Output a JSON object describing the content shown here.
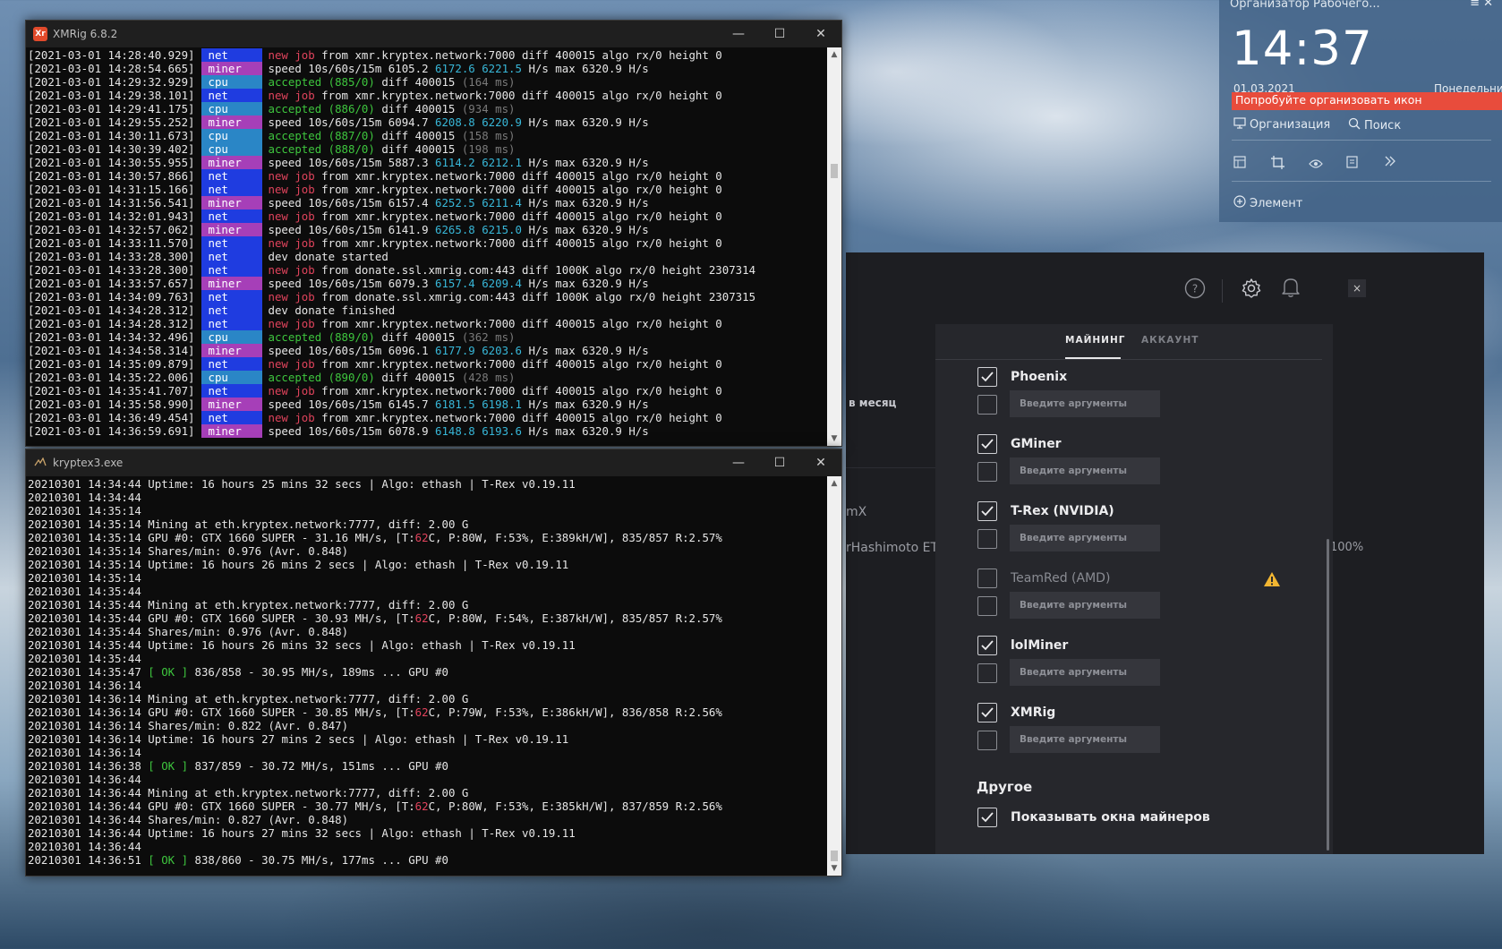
{
  "desktop": {
    "fences": {
      "header": "Организатор Рабочего...",
      "menu_glyph": "≡ ✕",
      "clock": "14:37",
      "date": "01.03.2021",
      "day": "Понедельник",
      "banner": "Попробуйте организовать икон",
      "organize_label": "Организация",
      "search_label": "Поиск",
      "element_label": "Элемент"
    }
  },
  "xmrig": {
    "title": "XMRig 6.8.2",
    "icon_text": "Xr",
    "lines": [
      {
        "ts": "[2021-03-01 14:28:40.929]",
        "tag": "net",
        "text": "new job from xmr.kryptex.network:7000 diff 400015 algo rx/0 height 0",
        "kind": "job"
      },
      {
        "ts": "[2021-03-01 14:28:54.665]",
        "tag": "miner",
        "text": "speed 10s/60s/15m 6105.2 6172.6 6221.5 H/s max 6320.9 H/s",
        "kind": "speed",
        "s1": "6105.2",
        "s2": "6172.6 6221.5",
        "max": "6320.9"
      },
      {
        "ts": "[2021-03-01 14:29:32.929]",
        "tag": "cpu",
        "text": "accepted (885/0) diff 400015 (164 ms)",
        "kind": "acc",
        "count": "(885/0)",
        "ms": "(164 ms)"
      },
      {
        "ts": "[2021-03-01 14:29:38.101]",
        "tag": "net",
        "text": "new job from xmr.kryptex.network:7000 diff 400015 algo rx/0 height 0",
        "kind": "job"
      },
      {
        "ts": "[2021-03-01 14:29:41.175]",
        "tag": "cpu",
        "text": "accepted (886/0) diff 400015 (934 ms)",
        "kind": "acc",
        "count": "(886/0)",
        "ms": "(934 ms)"
      },
      {
        "ts": "[2021-03-01 14:29:55.252]",
        "tag": "miner",
        "text": "speed",
        "kind": "speed",
        "s1": "6094.7",
        "s2": "6208.8 6220.9",
        "max": "6320.9"
      },
      {
        "ts": "[2021-03-01 14:30:11.673]",
        "tag": "cpu",
        "text": "accepted",
        "kind": "acc",
        "count": "(887/0)",
        "ms": "(158 ms)"
      },
      {
        "ts": "[2021-03-01 14:30:39.402]",
        "tag": "cpu",
        "text": "accepted",
        "kind": "acc",
        "count": "(888/0)",
        "ms": "(198 ms)"
      },
      {
        "ts": "[2021-03-01 14:30:55.955]",
        "tag": "miner",
        "text": "speed",
        "kind": "speed",
        "s1": "5887.3",
        "s2": "6114.2 6212.1",
        "max": "6320.9"
      },
      {
        "ts": "[2021-03-01 14:30:57.866]",
        "tag": "net",
        "text": "new job from xmr.kryptex.network:7000 diff 400015 algo rx/0 height 0",
        "kind": "job"
      },
      {
        "ts": "[2021-03-01 14:31:15.166]",
        "tag": "net",
        "text": "new job from xmr.kryptex.network:7000 diff 400015 algo rx/0 height 0",
        "kind": "job"
      },
      {
        "ts": "[2021-03-01 14:31:56.541]",
        "tag": "miner",
        "text": "speed",
        "kind": "speed",
        "s1": "6157.4",
        "s2": "6252.5 6211.4",
        "max": "6320.9"
      },
      {
        "ts": "[2021-03-01 14:32:01.943]",
        "tag": "net",
        "text": "new job from xmr.kryptex.network:7000 diff 400015 algo rx/0 height 0",
        "kind": "job"
      },
      {
        "ts": "[2021-03-01 14:32:57.062]",
        "tag": "miner",
        "text": "speed",
        "kind": "speed",
        "s1": "6141.9",
        "s2": "6265.8 6215.0",
        "max": "6320.9"
      },
      {
        "ts": "[2021-03-01 14:33:11.570]",
        "tag": "net",
        "text": "new job from xmr.kryptex.network:7000 diff 400015 algo rx/0 height 0",
        "kind": "job"
      },
      {
        "ts": "[2021-03-01 14:33:28.300]",
        "tag": "net",
        "text": "dev donate started",
        "kind": "plain"
      },
      {
        "ts": "[2021-03-01 14:33:28.300]",
        "tag": "net",
        "text": "new job from donate.ssl.xmrig.com:443 diff 1000K algo rx/0 height 2307314",
        "kind": "job"
      },
      {
        "ts": "[2021-03-01 14:33:57.657]",
        "tag": "miner",
        "text": "speed",
        "kind": "speed",
        "s1": "6079.3",
        "s2": "6157.4 6209.4",
        "max": "6320.9"
      },
      {
        "ts": "[2021-03-01 14:34:09.763]",
        "tag": "net",
        "text": "new job from donate.ssl.xmrig.com:443 diff 1000K algo rx/0 height 2307315",
        "kind": "job"
      },
      {
        "ts": "[2021-03-01 14:34:28.312]",
        "tag": "net",
        "text": "dev donate finished",
        "kind": "plain"
      },
      {
        "ts": "[2021-03-01 14:34:28.312]",
        "tag": "net",
        "text": "new job from xmr.kryptex.network:7000 diff 400015 algo rx/0 height 0",
        "kind": "job"
      },
      {
        "ts": "[2021-03-01 14:34:32.496]",
        "tag": "cpu",
        "text": "accepted",
        "kind": "acc",
        "count": "(889/0)",
        "ms": "(362 ms)"
      },
      {
        "ts": "[2021-03-01 14:34:58.314]",
        "tag": "miner",
        "text": "speed",
        "kind": "speed",
        "s1": "6096.1",
        "s2": "6177.9 6203.6",
        "max": "6320.9"
      },
      {
        "ts": "[2021-03-01 14:35:09.879]",
        "tag": "net",
        "text": "new job from xmr.kryptex.network:7000 diff 400015 algo rx/0 height 0",
        "kind": "job"
      },
      {
        "ts": "[2021-03-01 14:35:22.006]",
        "tag": "cpu",
        "text": "accepted",
        "kind": "acc",
        "count": "(890/0)",
        "ms": "(428 ms)"
      },
      {
        "ts": "[2021-03-01 14:35:41.707]",
        "tag": "net",
        "text": "new job from xmr.kryptex.network:7000 diff 400015 algo rx/0 height 0",
        "kind": "job"
      },
      {
        "ts": "[2021-03-01 14:35:58.990]",
        "tag": "miner",
        "text": "speed",
        "kind": "speed",
        "s1": "6145.7",
        "s2": "6181.5 6198.1",
        "max": "6320.9"
      },
      {
        "ts": "[2021-03-01 14:36:49.454]",
        "tag": "net",
        "text": "new job from xmr.kryptex.network:7000 diff 400015 algo rx/0 height 0",
        "kind": "job"
      },
      {
        "ts": "[2021-03-01 14:36:59.691]",
        "tag": "miner",
        "text": "speed",
        "kind": "speed",
        "s1": "6078.9",
        "s2": "6148.8 6193.6",
        "max": "6320.9"
      }
    ]
  },
  "trex": {
    "title": "kryptex3.exe",
    "lines": [
      {
        "text": "20210301 14:34:44 Uptime: 16 hours 25 mins 32 secs | Algo: ethash | T-Rex v0.19.11"
      },
      {
        "text": "20210301 14:34:44"
      },
      {
        "text": "20210301 14:35:14"
      },
      {
        "text": "20210301 14:35:14 Mining at eth.kryptex.network:7777, diff: 2.00 G"
      },
      {
        "pre": "20210301 14:35:14 GPU #0: GTX 1660 SUPER - 31.16 MH/s, [T:",
        "temp": "62",
        "post": "C, P:80W, F:53%, E:389kH/W], 835/857 R:2.57%"
      },
      {
        "text": "20210301 14:35:14 Shares/min: 0.976 (Avr. 0.848)"
      },
      {
        "text": "20210301 14:35:14 Uptime: 16 hours 26 mins 2 secs | Algo: ethash | T-Rex v0.19.11"
      },
      {
        "text": "20210301 14:35:14"
      },
      {
        "text": "20210301 14:35:44"
      },
      {
        "text": "20210301 14:35:44 Mining at eth.kryptex.network:7777, diff: 2.00 G"
      },
      {
        "pre": "20210301 14:35:44 GPU #0: GTX 1660 SUPER - 30.93 MH/s, [T:",
        "temp": "62",
        "post": "C, P:80W, F:54%, E:387kH/W], 835/857 R:2.57%"
      },
      {
        "text": "20210301 14:35:44 Shares/min: 0.976 (Avr. 0.848)"
      },
      {
        "text": "20210301 14:35:44 Uptime: 16 hours 26 mins 32 secs | Algo: ethash | T-Rex v0.19.11"
      },
      {
        "text": "20210301 14:35:44"
      },
      {
        "okpre": "20210301 14:35:47 ",
        "ok": "[ OK ]",
        "okpost": " 836/858 - 30.95 MH/s, 189ms ... GPU #0"
      },
      {
        "text": "20210301 14:36:14"
      },
      {
        "text": "20210301 14:36:14 Mining at eth.kryptex.network:7777, diff: 2.00 G"
      },
      {
        "pre": "20210301 14:36:14 GPU #0: GTX 1660 SUPER - 30.85 MH/s, [T:",
        "temp": "62",
        "post": "C, P:79W, F:53%, E:386kH/W], 836/858 R:2.56%"
      },
      {
        "text": "20210301 14:36:14 Shares/min: 0.822 (Avr. 0.847)"
      },
      {
        "text": "20210301 14:36:14 Uptime: 16 hours 27 mins 2 secs | Algo: ethash | T-Rex v0.19.11"
      },
      {
        "text": "20210301 14:36:14"
      },
      {
        "okpre": "20210301 14:36:38 ",
        "ok": "[ OK ]",
        "okpost": " 837/859 - 30.72 MH/s, 151ms ... GPU #0"
      },
      {
        "text": "20210301 14:36:44"
      },
      {
        "text": "20210301 14:36:44 Mining at eth.kryptex.network:7777, diff: 2.00 G"
      },
      {
        "pre": "20210301 14:36:44 GPU #0: GTX 1660 SUPER - 30.77 MH/s, [T:",
        "temp": "62",
        "post": "C, P:80W, F:53%, E:385kH/W], 837/859 R:2.56%"
      },
      {
        "text": "20210301 14:36:44 Shares/min: 0.827 (Avr. 0.848)"
      },
      {
        "text": "20210301 14:36:44 Uptime: 16 hours 27 mins 32 secs | Algo: ethash | T-Rex v0.19.11"
      },
      {
        "text": "20210301 14:36:44"
      },
      {
        "okpre": "20210301 14:36:51 ",
        "ok": "[ OK ]",
        "okpost": " 838/860 - 30.75 MH/s, 177ms ... GPU #0"
      }
    ]
  },
  "kryptex": {
    "left_texts": [
      "в месяц",
      "mX",
      "rHashimoto ETH",
      "100%"
    ],
    "tabs": {
      "mining": "МАЙНИНГ",
      "account": "АККАУНТ"
    },
    "arg_placeholder": "Введите аргументы",
    "miners": [
      {
        "name": "Phoenix",
        "enabled": true,
        "warning": false
      },
      {
        "name": "GMiner",
        "enabled": true,
        "warning": false
      },
      {
        "name": "T-Rex (NVIDIA)",
        "enabled": true,
        "warning": false
      },
      {
        "name": "TeamRed (AMD)",
        "enabled": false,
        "warning": true
      },
      {
        "name": "lolMiner",
        "enabled": true,
        "warning": false
      },
      {
        "name": "XMRig",
        "enabled": true,
        "warning": false
      }
    ],
    "other_title": "Другое",
    "show_windows_label": "Показывать окна майнеров",
    "show_windows_checked": true
  }
}
